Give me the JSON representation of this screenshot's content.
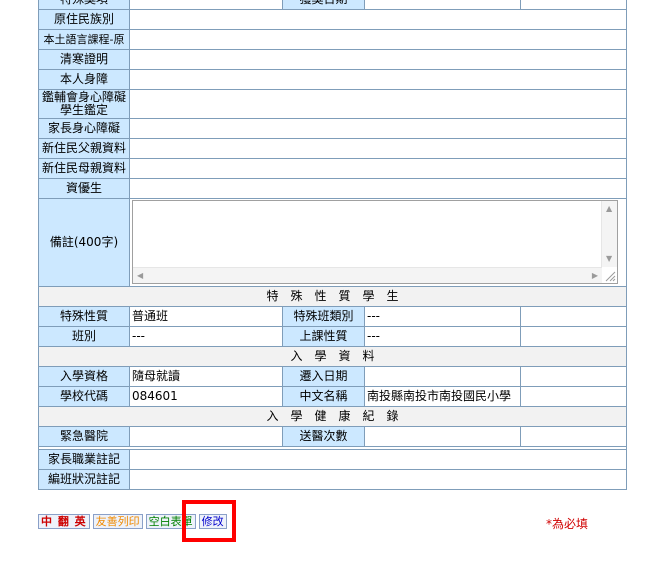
{
  "form": {
    "rows": {
      "special_award": "特殊獎項",
      "award_date": "獲獎日期",
      "aboriginal_ethnicity": "原住民族別",
      "native_language": "本土語言課程-原",
      "poverty_proof": "清寒證明",
      "self_disability": "本人身障",
      "disability_assessment": "鑑輔會身心障礙學生鑑定",
      "parent_disability": "家長身心障礙",
      "new_immigrant_father": "新住民父親資料",
      "new_immigrant_mother": "新住民母親資料",
      "gifted_student": "資優生",
      "remarks": "備註(400字)"
    },
    "section_special": "特　殊　性　質　學　生",
    "special_nature_label": "特殊性質",
    "special_nature_value": "普通班",
    "special_class_type_label": "特殊班類別",
    "special_class_type_value": "---",
    "class_label": "班別",
    "class_value": "---",
    "course_nature_label": "上課性質",
    "course_nature_value": "---",
    "section_enrollment": "入　學　資　料",
    "admission_label": "入學資格",
    "admission_value": "隨母就讀",
    "move_in_date_label": "遷入日期",
    "move_in_date_value": "",
    "school_code_label": "學校代碼",
    "school_code_value": "084601",
    "chinese_name_label": "中文名稱",
    "chinese_name_value": "南投縣南投市南投國民小學",
    "section_health": "入　學　健　康　紀　錄",
    "emergency_hospital_label": "緊急醫院",
    "emergency_hospital_value": "",
    "hospital_visits_label": "送醫次數",
    "hospital_visits_value": "",
    "parent_occupation_label": "家長職業註記",
    "class_placement_label": "編班狀況註記"
  },
  "toolbar": {
    "chinese_label": "中 翻 英",
    "friendly_print_label": "友善列印",
    "blank_form_label": "空白表單",
    "edit_label": "修改"
  },
  "required_note": "*為必填",
  "colors": {
    "label_bg": "#cce8ff",
    "section_bg": "#f2f2f2",
    "border": "#7f9db9",
    "highlight": "#ff0000"
  }
}
